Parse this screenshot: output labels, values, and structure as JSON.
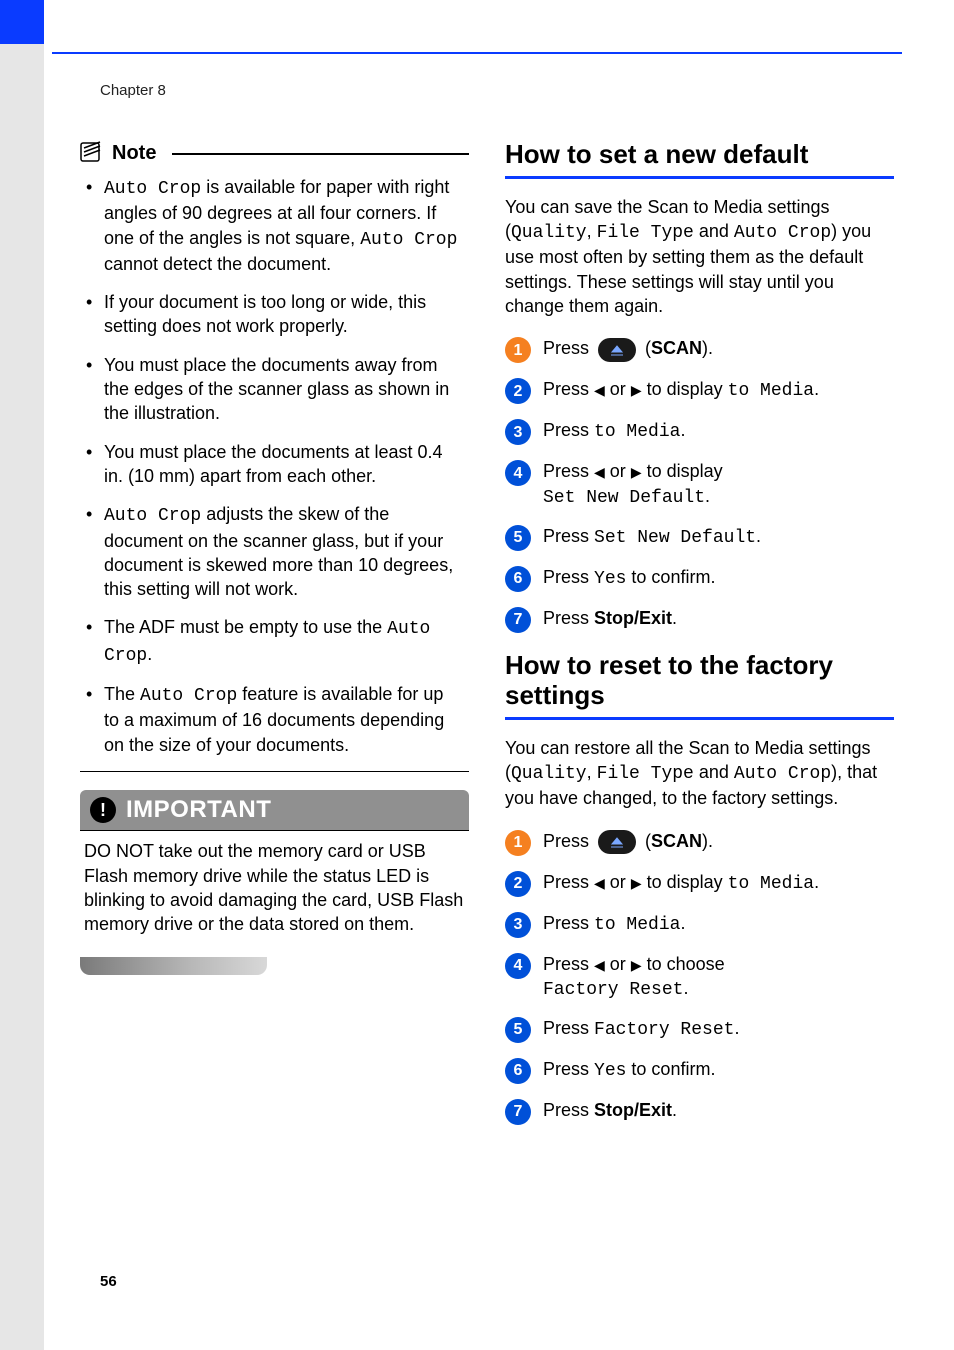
{
  "header": {
    "chapter": "Chapter 8"
  },
  "left": {
    "note_label": "Note",
    "bullets": [
      {
        "a": "Auto Crop",
        "b": " is available for paper with right angles of 90 degrees at all four corners. If one of the angles is not square, ",
        "c": "Auto Crop",
        "d": " cannot detect the document."
      },
      {
        "a": "If your document is too long or wide, this setting does not work properly."
      },
      {
        "a": "You must place the documents away from the edges of the scanner glass as shown in the illustration."
      },
      {
        "a": "You must place the documents at least 0.4 in. (10 mm) apart from each other."
      },
      {
        "a": "Auto Crop",
        "b": " adjusts the skew of the document on the scanner glass, but if your document is skewed more than 10 degrees, this setting will not work."
      },
      {
        "a": "The ADF must be empty to use the ",
        "b": "Auto Crop",
        "c": "."
      },
      {
        "a": "The ",
        "b": "Auto Crop",
        "c": " feature is available for up to a maximum of 16 documents depending on the size of your documents."
      }
    ],
    "important_label": "IMPORTANT",
    "important_body": "DO NOT take out the memory card or USB Flash memory drive while the status LED is blinking to avoid damaging the card, USB Flash memory drive or the data stored on them."
  },
  "right": {
    "section1": {
      "title": "How to set a new default",
      "intro": {
        "a": "You can save the Scan to Media settings (",
        "b": "Quality",
        "c": ", ",
        "d": "File Type",
        "e": " and ",
        "f": "Auto Crop",
        "g": ") you use most often by setting them as the default settings. These settings will stay until you change them again."
      },
      "steps": [
        {
          "n": "1",
          "a": "Press ",
          "b": " (",
          "c": "SCAN",
          "d": ")."
        },
        {
          "n": "2",
          "a": "Press ",
          "b": " or ",
          "c": " to display ",
          "d": "to Media",
          "e": "."
        },
        {
          "n": "3",
          "a": "Press ",
          "b": "to Media",
          "c": "."
        },
        {
          "n": "4",
          "a": "Press ",
          "b": " or ",
          "c": " to display ",
          "d": "Set New Default",
          "e": "."
        },
        {
          "n": "5",
          "a": "Press ",
          "b": "Set New Default",
          "c": "."
        },
        {
          "n": "6",
          "a": "Press ",
          "b": "Yes",
          "c": " to confirm."
        },
        {
          "n": "7",
          "a": "Press ",
          "b": "Stop/Exit",
          "c": "."
        }
      ]
    },
    "section2": {
      "title": "How to reset to the factory settings",
      "intro": {
        "a": "You can restore all the Scan to Media settings (",
        "b": "Quality",
        "c": ", ",
        "d": "File Type",
        "e": " and ",
        "f": "Auto Crop",
        "g": "), that you have changed, to the factory settings."
      },
      "steps": [
        {
          "n": "1",
          "a": "Press ",
          "b": " (",
          "c": "SCAN",
          "d": ")."
        },
        {
          "n": "2",
          "a": "Press ",
          "b": " or ",
          "c": " to display ",
          "d": "to Media",
          "e": "."
        },
        {
          "n": "3",
          "a": "Press ",
          "b": "to Media",
          "c": "."
        },
        {
          "n": "4",
          "a": "Press ",
          "b": " or ",
          "c": " to choose ",
          "d": "Factory Reset",
          "e": "."
        },
        {
          "n": "5",
          "a": "Press ",
          "b": "Factory Reset",
          "c": "."
        },
        {
          "n": "6",
          "a": "Press ",
          "b": "Yes",
          "c": " to confirm."
        },
        {
          "n": "7",
          "a": "Press ",
          "b": "Stop/Exit",
          "c": "."
        }
      ]
    }
  },
  "footer": {
    "page": "56"
  }
}
